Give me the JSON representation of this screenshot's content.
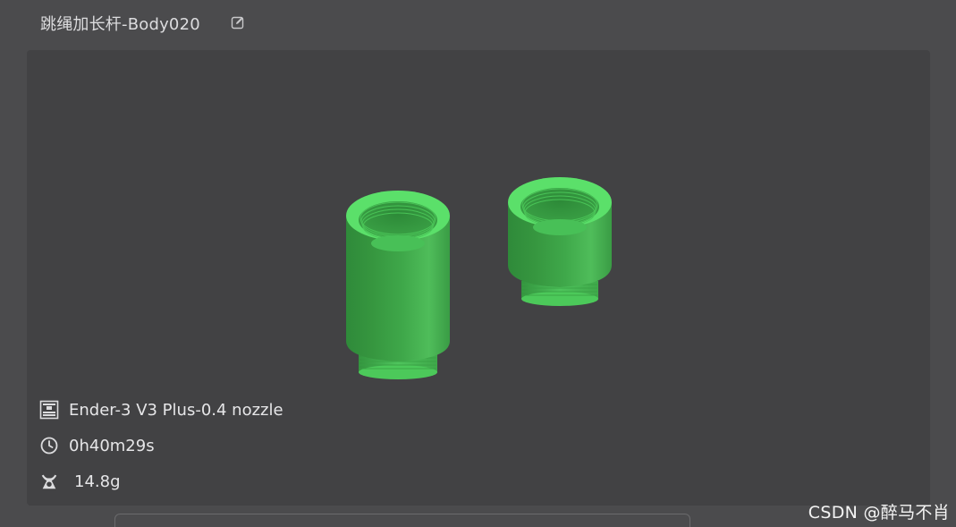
{
  "title": {
    "text": "跳绳加长杆-Body020"
  },
  "icons": {
    "edit": "edit-pencil-icon",
    "printer": "printer-icon",
    "time": "clock-icon",
    "weight": "weight-icon"
  },
  "info": {
    "printer": "Ender-3 V3 Plus-0.4 nozzle",
    "time": "0h40m29s",
    "weight": "14.8g"
  },
  "colors": {
    "background": "#4b4b4d",
    "preview_background": "#424244",
    "model_green": "#4cc95a",
    "text": "#e6e6e8"
  },
  "watermark": {
    "text": "CSDN @醉马不肖"
  }
}
